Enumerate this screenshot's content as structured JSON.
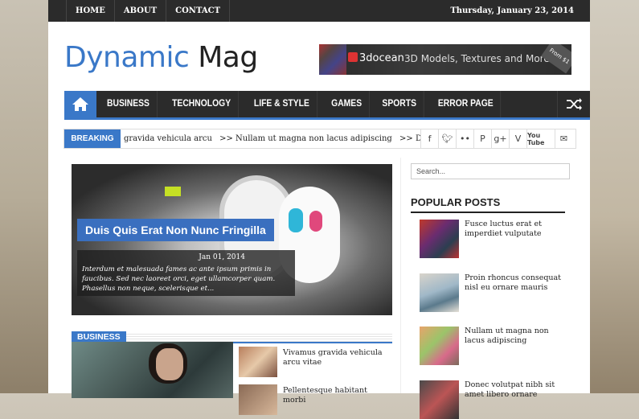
{
  "topbar": {
    "nav": [
      "HOME",
      "ABOUT",
      "CONTACT"
    ],
    "date": "Thursday, January 23, 2014"
  },
  "header": {
    "logo_part1": "Dynamic",
    "logo_part2": "Mag",
    "ad": {
      "brand": "3docean",
      "tagline": "3D Models, Textures and More",
      "badge": "From $1"
    }
  },
  "mainnav": {
    "items": [
      "BUSINESS",
      "TECHNOLOGY",
      "LIFE & STYLE",
      "GAMES",
      "SPORTS",
      "ERROR PAGE"
    ]
  },
  "breaking": {
    "label": "BREAKING NEWS",
    "items": [
      "gravida vehicula arcu",
      ">> Nullam ut magna non lacus adipiscing",
      ">> Duis quis erat n"
    ]
  },
  "social": {
    "icons": [
      "facebook-icon",
      "twitter-icon",
      "flickr-icon",
      "pinterest-icon",
      "googleplus-icon",
      "vimeo-icon",
      "youtube-icon",
      "email-icon"
    ],
    "youtube_label": "You Tube"
  },
  "featured": {
    "title": "Duis Quis Erat Non Nunc Fringilla",
    "date": "Jan 01, 2014",
    "excerpt": "Interdum et malesuada fames ac ante ipsum primis in faucibus. Sed nec laoreet orci, eget ullamcorper quam. Phasellus non neque, scelerisque et..."
  },
  "business": {
    "label": "BUSINESS",
    "items": [
      "Vivamus gravida vehicula arcu vitae",
      "Pellentesque habitant morbi"
    ]
  },
  "sidebar": {
    "search_placeholder": "Search...",
    "popular_title": "POPULAR POSTS",
    "posts": [
      "Fusce luctus erat et imperdiet vulputate",
      "Proin rhoncus consequat nisl eu ornare mauris",
      "Nullam ut magna non lacus adipiscing",
      "Donec volutpat nibh sit amet libero ornare"
    ]
  },
  "colors": {
    "accent": "#3a78c8",
    "dark": "#2b2b2b"
  }
}
